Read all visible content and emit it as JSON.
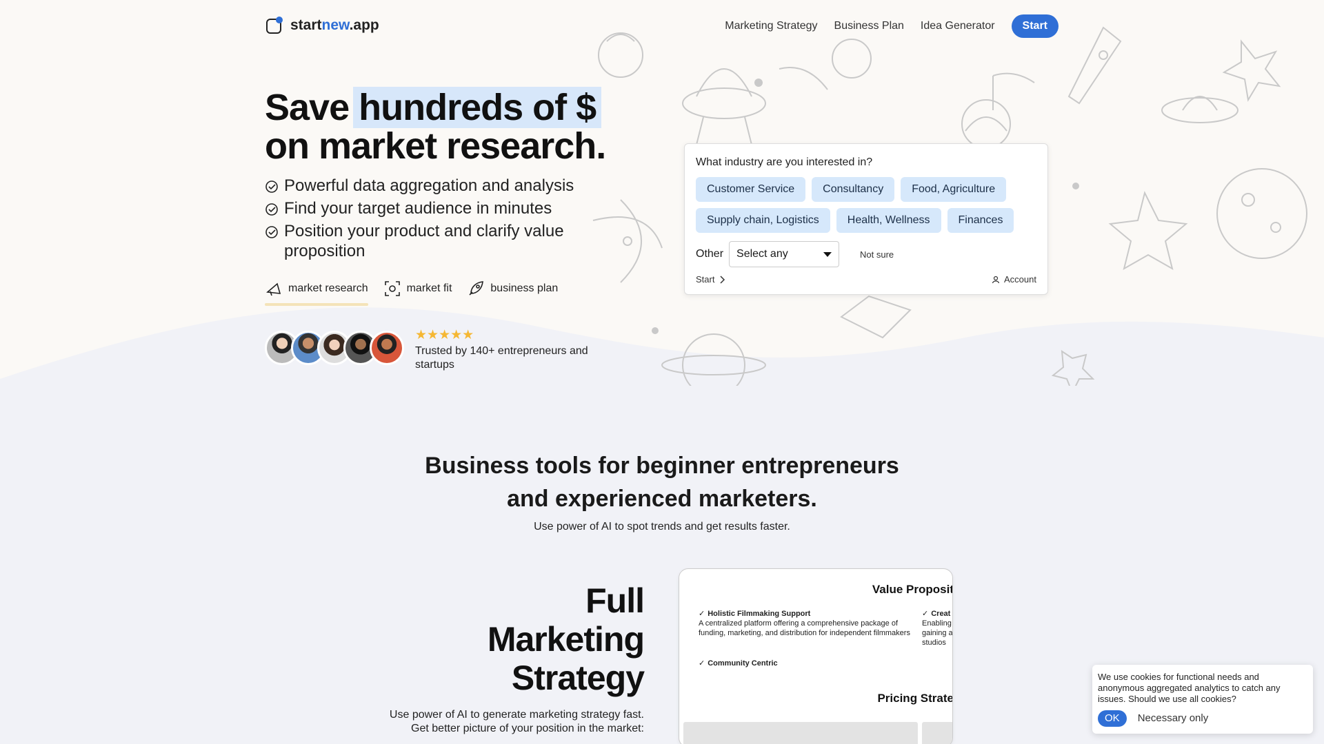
{
  "header": {
    "logo_text_start": "start",
    "logo_text_new": "new",
    "logo_text_end": ".app",
    "nav": [
      "Marketing Strategy",
      "Business Plan",
      "Idea Generator"
    ],
    "start_button": "Start"
  },
  "hero": {
    "headline_1": "Save",
    "headline_highlight": "hundreds of $",
    "headline_2": "on market research.",
    "features": [
      "Powerful data aggregation and analysis",
      "Find your target audience in minutes",
      "Position your product and clarify value proposition"
    ],
    "tags": [
      {
        "label": "market research",
        "icon": "megaphone-icon"
      },
      {
        "label": "market fit",
        "icon": "focus-frame-icon"
      },
      {
        "label": "business plan",
        "icon": "rocket-icon"
      }
    ],
    "stars": "★★★★★",
    "trusted": "Trusted by 140+ entrepreneurs and startups"
  },
  "industry_card": {
    "question": "What industry are you interested in?",
    "chips": [
      "Customer Service",
      "Consultancy",
      "Food, Agriculture",
      "Supply chain, Logistics",
      "Health, Wellness",
      "Finances"
    ],
    "other_label": "Other",
    "select_value": "Select any",
    "not_sure": "Not sure",
    "start_link": "Start",
    "account_link": "Account"
  },
  "section2": {
    "title_line1": "Business tools for beginner entrepreneurs",
    "title_line2": "and experienced marketers.",
    "subtitle": "Use power of AI to spot trends and get results faster.",
    "feature_title_1": "Full",
    "feature_title_2": "Marketing",
    "feature_title_3": "Strategy",
    "feature_desc_1": "Use power of AI to generate marketing strategy fast.",
    "feature_desc_2": "Get better picture of your position in the market:"
  },
  "preview": {
    "title": "Value Proposit",
    "item1_title": "Holistic Filmmaking Support",
    "item1_desc": "A centralized platform offering a comprehensive package of funding, marketing, and distribution for independent filmmakers",
    "item2_title": "Creat",
    "item2_desc": "Enabling gaining a studios",
    "item3_title": "Community Centric",
    "pricing": "Pricing Strate"
  },
  "cookie": {
    "text": "We use cookies for functional needs and anonymous aggregated analytics to catch any issues. Should we use all cookies?",
    "ok": "OK",
    "necessary": "Necessary only"
  },
  "colors": {
    "accent": "#2f6fd6",
    "chip_bg": "#d6e8fb",
    "highlight_bg": "#d7e7fa",
    "star": "#f5b733",
    "hero_bg": "#fbf9f6",
    "page_bg": "#f1f2f7"
  }
}
